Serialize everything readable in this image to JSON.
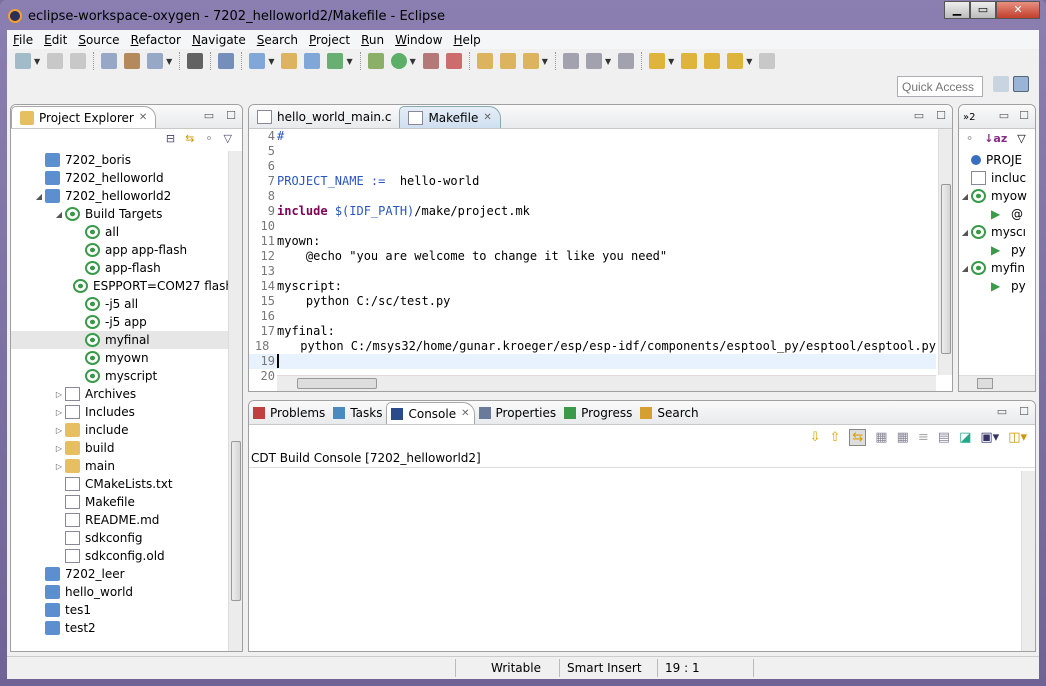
{
  "window": {
    "title": "eclipse-workspace-oxygen - 7202_helloworld2/Makefile - Eclipse",
    "minimize": "▁",
    "maximize": "▭",
    "close": "✕"
  },
  "menu": [
    "File",
    "Edit",
    "Source",
    "Refactor",
    "Navigate",
    "Search",
    "Project",
    "Run",
    "Window",
    "Help"
  ],
  "quick_access": {
    "placeholder": "Quick Access"
  },
  "explorer": {
    "title": "Project Explorer",
    "items": [
      {
        "label": "7202_boris",
        "level": 0,
        "icon": "project-folder",
        "arrow": ""
      },
      {
        "label": "7202_helloworld",
        "level": 0,
        "icon": "project-folder",
        "arrow": ""
      },
      {
        "label": "7202_helloworld2",
        "level": 0,
        "icon": "c-project-folder",
        "arrow": "expanded"
      },
      {
        "label": "Build Targets",
        "level": 1,
        "icon": "build-target",
        "arrow": "expanded"
      },
      {
        "label": "all",
        "level": 2,
        "icon": "build-target",
        "arrow": ""
      },
      {
        "label": "app app-flash",
        "level": 2,
        "icon": "build-target",
        "arrow": ""
      },
      {
        "label": "app-flash",
        "level": 2,
        "icon": "build-target",
        "arrow": ""
      },
      {
        "label": "ESPPORT=COM27 flash",
        "level": 2,
        "icon": "build-target",
        "arrow": ""
      },
      {
        "label": "-j5 all",
        "level": 2,
        "icon": "build-target",
        "arrow": ""
      },
      {
        "label": "-j5 app",
        "level": 2,
        "icon": "build-target",
        "arrow": ""
      },
      {
        "label": "myfinal",
        "level": 2,
        "icon": "build-target",
        "arrow": "",
        "selected": true
      },
      {
        "label": "myown",
        "level": 2,
        "icon": "build-target",
        "arrow": ""
      },
      {
        "label": "myscript",
        "level": 2,
        "icon": "build-target",
        "arrow": ""
      },
      {
        "label": "Archives",
        "level": 1,
        "icon": "archives",
        "arrow": "collapsed"
      },
      {
        "label": "Includes",
        "level": 1,
        "icon": "includes",
        "arrow": "collapsed"
      },
      {
        "label": "include",
        "level": 1,
        "icon": "folder",
        "arrow": "collapsed"
      },
      {
        "label": "build",
        "level": 1,
        "icon": "folder",
        "arrow": "collapsed"
      },
      {
        "label": "main",
        "level": 1,
        "icon": "folder",
        "arrow": "collapsed"
      },
      {
        "label": "CMakeLists.txt",
        "level": 1,
        "icon": "file",
        "arrow": ""
      },
      {
        "label": "Makefile",
        "level": 1,
        "icon": "makefile",
        "arrow": ""
      },
      {
        "label": "README.md",
        "level": 1,
        "icon": "word-file",
        "arrow": ""
      },
      {
        "label": "sdkconfig",
        "level": 1,
        "icon": "file",
        "arrow": ""
      },
      {
        "label": "sdkconfig.old",
        "level": 1,
        "icon": "file",
        "arrow": ""
      },
      {
        "label": "7202_leer",
        "level": 0,
        "icon": "project-folder",
        "arrow": ""
      },
      {
        "label": "hello_world",
        "level": 0,
        "icon": "project-folder",
        "arrow": ""
      },
      {
        "label": "tes1",
        "level": 0,
        "icon": "project-folder",
        "arrow": ""
      },
      {
        "label": "test2",
        "level": 0,
        "icon": "project-folder",
        "arrow": ""
      }
    ]
  },
  "editor": {
    "tabs": [
      {
        "label": "hello_world_main.c",
        "active": false
      },
      {
        "label": "Makefile",
        "active": true
      }
    ],
    "lines": [
      {
        "n": "4",
        "parts": [
          [
            "var",
            "#"
          ]
        ]
      },
      {
        "n": "5",
        "parts": []
      },
      {
        "n": "6",
        "parts": []
      },
      {
        "n": "7",
        "parts": [
          [
            "var",
            "PROJECT_NAME :="
          ],
          [
            "",
            "  hello-world"
          ]
        ]
      },
      {
        "n": "8",
        "parts": []
      },
      {
        "n": "9",
        "parts": [
          [
            "kw",
            "include"
          ],
          [
            "",
            " "
          ],
          [
            "var",
            "$(IDF_PATH)"
          ],
          [
            "",
            "/make/project.mk"
          ]
        ]
      },
      {
        "n": "10",
        "parts": []
      },
      {
        "n": "11",
        "parts": [
          [
            "",
            "myown:"
          ]
        ]
      },
      {
        "n": "12",
        "parts": [
          [
            "",
            "    @echo \"you are welcome to change it like you need\""
          ]
        ]
      },
      {
        "n": "13",
        "parts": []
      },
      {
        "n": "14",
        "parts": [
          [
            "",
            "myscript:"
          ]
        ]
      },
      {
        "n": "15",
        "parts": [
          [
            "",
            "    python C:/sc/test.py"
          ]
        ]
      },
      {
        "n": "16",
        "parts": []
      },
      {
        "n": "17",
        "parts": [
          [
            "",
            "myfinal:"
          ]
        ]
      },
      {
        "n": "18",
        "parts": [
          [
            "",
            "    python C:/msys32/home/gunar.kroeger/esp/esp-idf/components/esptool_py/esptool/esptool.py"
          ]
        ]
      },
      {
        "n": "19",
        "parts": [],
        "current": true
      },
      {
        "n": "20",
        "parts": []
      }
    ]
  },
  "outline": {
    "overflow": "»2",
    "items": [
      {
        "label": "PROJE",
        "level": 0,
        "icon": "variable",
        "arrow": ""
      },
      {
        "label": "incluc",
        "level": 0,
        "icon": "include-file",
        "arrow": ""
      },
      {
        "label": "myow",
        "level": 0,
        "icon": "build-target",
        "arrow": "expanded"
      },
      {
        "label": "@",
        "level": 1,
        "icon": "run-command",
        "arrow": ""
      },
      {
        "label": "myscı",
        "level": 0,
        "icon": "build-target",
        "arrow": "expanded"
      },
      {
        "label": "py",
        "level": 1,
        "icon": "run-command",
        "arrow": ""
      },
      {
        "label": "myfin",
        "level": 0,
        "icon": "build-target",
        "arrow": "expanded"
      },
      {
        "label": "py",
        "level": 1,
        "icon": "run-command",
        "arrow": ""
      }
    ]
  },
  "console": {
    "tabs": [
      {
        "label": "Problems",
        "icon": "problems-icon"
      },
      {
        "label": "Tasks",
        "icon": "tasks-icon"
      },
      {
        "label": "Console",
        "icon": "console-icon",
        "active": true
      },
      {
        "label": "Properties",
        "icon": "properties-icon"
      },
      {
        "label": "Progress",
        "icon": "progress-icon"
      },
      {
        "label": "Search",
        "icon": "search-icon"
      }
    ],
    "name": "CDT Build Console [7202_helloworld2]"
  },
  "status": {
    "mode": "Writable",
    "insert": "Smart Insert",
    "position": "19 : 1"
  },
  "colors": {
    "keyword": "#7f0055",
    "variable": "#2a55c0",
    "target": "#3a9a4a",
    "selection": "#e6e6e6",
    "current_line": "#e8f2fe"
  }
}
